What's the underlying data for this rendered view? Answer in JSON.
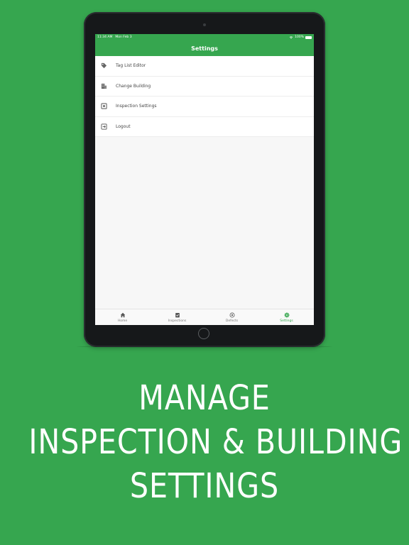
{
  "status_bar": {
    "time": "11:34 AM",
    "date": "Mon Feb 3",
    "battery": "100%"
  },
  "nav": {
    "title": "Settings"
  },
  "settings_items": [
    {
      "label": "Tag List Editor",
      "icon": "tag-icon"
    },
    {
      "label": "Change Building",
      "icon": "building-icon"
    },
    {
      "label": "Inspection Settings",
      "icon": "inspection-settings-icon"
    },
    {
      "label": "Logout",
      "icon": "logout-icon"
    }
  ],
  "tabs": [
    {
      "label": "Home",
      "icon": "home-icon",
      "active": false
    },
    {
      "label": "Inspections",
      "icon": "clipboard-check-icon",
      "active": false
    },
    {
      "label": "Defects",
      "icon": "defects-icon",
      "active": false
    },
    {
      "label": "Settings",
      "icon": "gear-icon",
      "active": true
    }
  ],
  "colors": {
    "brand_green": "#36a64f",
    "tab_inactive": "#777777"
  },
  "headline": {
    "line1": "MANAGE",
    "line2": "INSPECTION & BUILDING",
    "line3": "SETTINGS"
  }
}
